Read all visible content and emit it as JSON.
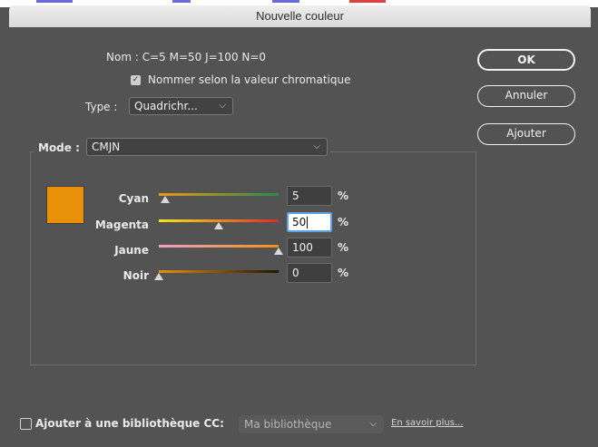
{
  "window": {
    "title": "Nouvelle couleur"
  },
  "name_row": {
    "label": "Nom :",
    "value": "C=5 M=50 J=100 N=0"
  },
  "name_by_value": {
    "label": "Nommer selon la valeur chromatique",
    "checked": true,
    "check_glyph": "✓"
  },
  "type": {
    "label": "Type :",
    "value": "Quadrichr...",
    "chevron": "⌵"
  },
  "mode": {
    "label": "Mode :",
    "value": "CMJN",
    "chevron": "⌵"
  },
  "buttons": {
    "ok": "OK",
    "cancel": "Annuler",
    "add": "Ajouter"
  },
  "swatch_color": "#E8900A",
  "sliders": [
    {
      "label": "Cyan",
      "value": "5",
      "unit": "%",
      "level": 0.05,
      "gradient": [
        "#E99A12",
        "#2C8A4E"
      ]
    },
    {
      "label": "Magenta",
      "value": "50",
      "unit": "%",
      "level": 0.5,
      "gradient": [
        "#F0E81E",
        "#E02A2A"
      ],
      "focused": true
    },
    {
      "label": "Jaune",
      "value": "100",
      "unit": "%",
      "level": 1.0,
      "gradient": [
        "#EBA0C8",
        "#EE930E"
      ]
    },
    {
      "label": "Noir",
      "value": "0",
      "unit": "%",
      "level": 0.0,
      "gradient": [
        "#E8900A",
        "#221405"
      ]
    }
  ],
  "library": {
    "checkbox_label": "Ajouter à une bibliothèque CC:",
    "checked": false,
    "select_value": "Ma bibliothèque",
    "chevron": "⌵",
    "learn_more": "En savoir plus..."
  },
  "colors": {
    "background": "#535353",
    "title_bar": "#E3E3E3",
    "focus_ring": "#5EA1E6"
  }
}
